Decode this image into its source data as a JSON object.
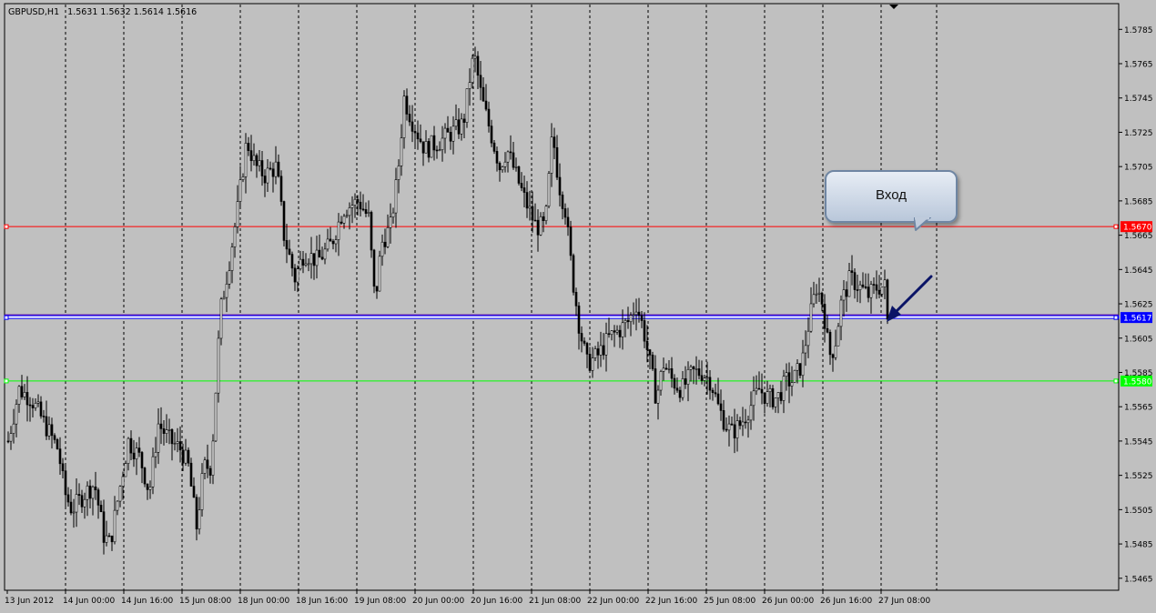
{
  "header": {
    "symbol": "GBPUSD,H1",
    "ohlc": "1.5631 1.5632 1.5614 1.5616"
  },
  "callout": {
    "text": "Вход"
  },
  "colors": {
    "background": "#c0c0c0",
    "grid": "#000000",
    "candle": "#000000",
    "resistance": "#ff0000",
    "entry": "#0000ff",
    "support": "#00ff00",
    "arrow": "#0a1466"
  },
  "chart_data": {
    "type": "candlestick",
    "symbol": "GBPUSD",
    "timeframe": "H1",
    "ylim": [
      1.5458,
      1.58
    ],
    "grid": "vertical dashed",
    "x_ticks": [
      "13 Jun 2012",
      "14 Jun 00:00",
      "14 Jun 16:00",
      "15 Jun 08:00",
      "18 Jun 00:00",
      "18 Jun 16:00",
      "19 Jun 08:00",
      "20 Jun 00:00",
      "20 Jun 16:00",
      "21 Jun 08:00",
      "22 Jun 00:00",
      "22 Jun 16:00",
      "25 Jun 08:00",
      "26 Jun 00:00",
      "26 Jun 16:00",
      "27 Jun 08:00"
    ],
    "y_ticks": [
      "1.5785",
      "1.5765",
      "1.5745",
      "1.5725",
      "1.5705",
      "1.5685",
      "1.5665",
      "1.5645",
      "1.5625",
      "1.5605",
      "1.5585",
      "1.5565",
      "1.5545",
      "1.5525",
      "1.5505",
      "1.5485",
      "1.5465"
    ],
    "y_tick_values": [
      1.5785,
      1.5765,
      1.5745,
      1.5725,
      1.5705,
      1.5685,
      1.5665,
      1.5645,
      1.5625,
      1.5605,
      1.5585,
      1.5565,
      1.5545,
      1.5525,
      1.5505,
      1.5485,
      1.5465
    ],
    "horizontal_lines": [
      {
        "value": 1.567,
        "label": "1.5670",
        "color": "#ff0000"
      },
      {
        "value": 1.5617,
        "label": "1.5617",
        "color": "#0000ff"
      },
      {
        "value": 1.558,
        "label": "1.5580",
        "color": "#00ff00"
      }
    ],
    "price_path": [
      [
        0,
        1.5545
      ],
      [
        12,
        1.5575
      ],
      [
        25,
        1.557
      ],
      [
        40,
        1.5555
      ],
      [
        55,
        1.554
      ],
      [
        62,
        1.5515
      ],
      [
        70,
        1.5505
      ],
      [
        85,
        1.5515
      ],
      [
        95,
        1.552
      ],
      [
        105,
        1.549
      ],
      [
        112,
        1.5485
      ],
      [
        120,
        1.551
      ],
      [
        132,
        1.5545
      ],
      [
        145,
        1.5535
      ],
      [
        155,
        1.5515
      ],
      [
        165,
        1.5555
      ],
      [
        178,
        1.5545
      ],
      [
        190,
        1.554
      ],
      [
        198,
        1.553
      ],
      [
        207,
        1.5495
      ],
      [
        215,
        1.553
      ],
      [
        223,
        1.553
      ],
      [
        228,
        1.5575
      ],
      [
        233,
        1.562
      ],
      [
        243,
        1.565
      ],
      [
        252,
        1.568
      ],
      [
        262,
        1.572
      ],
      [
        272,
        1.5705
      ],
      [
        282,
        1.57
      ],
      [
        295,
        1.5705
      ],
      [
        303,
        1.5665
      ],
      [
        315,
        1.564
      ],
      [
        325,
        1.5655
      ],
      [
        340,
        1.565
      ],
      [
        355,
        1.566
      ],
      [
        368,
        1.568
      ],
      [
        385,
        1.5685
      ],
      [
        396,
        1.5675
      ],
      [
        403,
        1.5625
      ],
      [
        410,
        1.566
      ],
      [
        420,
        1.567
      ],
      [
        428,
        1.57
      ],
      [
        435,
        1.5745
      ],
      [
        445,
        1.573
      ],
      [
        458,
        1.5715
      ],
      [
        475,
        1.572
      ],
      [
        488,
        1.5725
      ],
      [
        500,
        1.573
      ],
      [
        508,
        1.576
      ],
      [
        512,
        1.577
      ],
      [
        520,
        1.5745
      ],
      [
        530,
        1.5725
      ],
      [
        540,
        1.5705
      ],
      [
        548,
        1.5715
      ],
      [
        558,
        1.57
      ],
      [
        568,
        1.5685
      ],
      [
        580,
        1.567
      ],
      [
        590,
        1.567
      ],
      [
        598,
        1.5725
      ],
      [
        605,
        1.5695
      ],
      [
        612,
        1.568
      ],
      [
        620,
        1.564
      ],
      [
        628,
        1.561
      ],
      [
        636,
        1.559
      ],
      [
        648,
        1.5595
      ],
      [
        660,
        1.5605
      ],
      [
        672,
        1.561
      ],
      [
        682,
        1.5615
      ],
      [
        690,
        1.5625
      ],
      [
        698,
        1.561
      ],
      [
        705,
        1.559
      ],
      [
        712,
        1.557
      ],
      [
        720,
        1.559
      ],
      [
        730,
        1.558
      ],
      [
        740,
        1.5575
      ],
      [
        752,
        1.5585
      ],
      [
        762,
        1.5585
      ],
      [
        772,
        1.558
      ],
      [
        780,
        1.5565
      ],
      [
        788,
        1.5555
      ],
      [
        795,
        1.555
      ],
      [
        805,
        1.5555
      ],
      [
        815,
        1.5565
      ],
      [
        825,
        1.5575
      ],
      [
        835,
        1.557
      ],
      [
        845,
        1.557
      ],
      [
        855,
        1.558
      ],
      [
        862,
        1.558
      ],
      [
        872,
        1.559
      ],
      [
        880,
        1.5615
      ],
      [
        888,
        1.5635
      ],
      [
        895,
        1.5625
      ],
      [
        902,
        1.5595
      ],
      [
        908,
        1.56
      ],
      [
        915,
        1.5625
      ],
      [
        925,
        1.564
      ],
      [
        935,
        1.5635
      ],
      [
        945,
        1.563
      ],
      [
        955,
        1.5635
      ],
      [
        963,
        1.5635
      ],
      [
        969,
        1.5625
      ],
      [
        974,
        1.5616
      ]
    ]
  }
}
